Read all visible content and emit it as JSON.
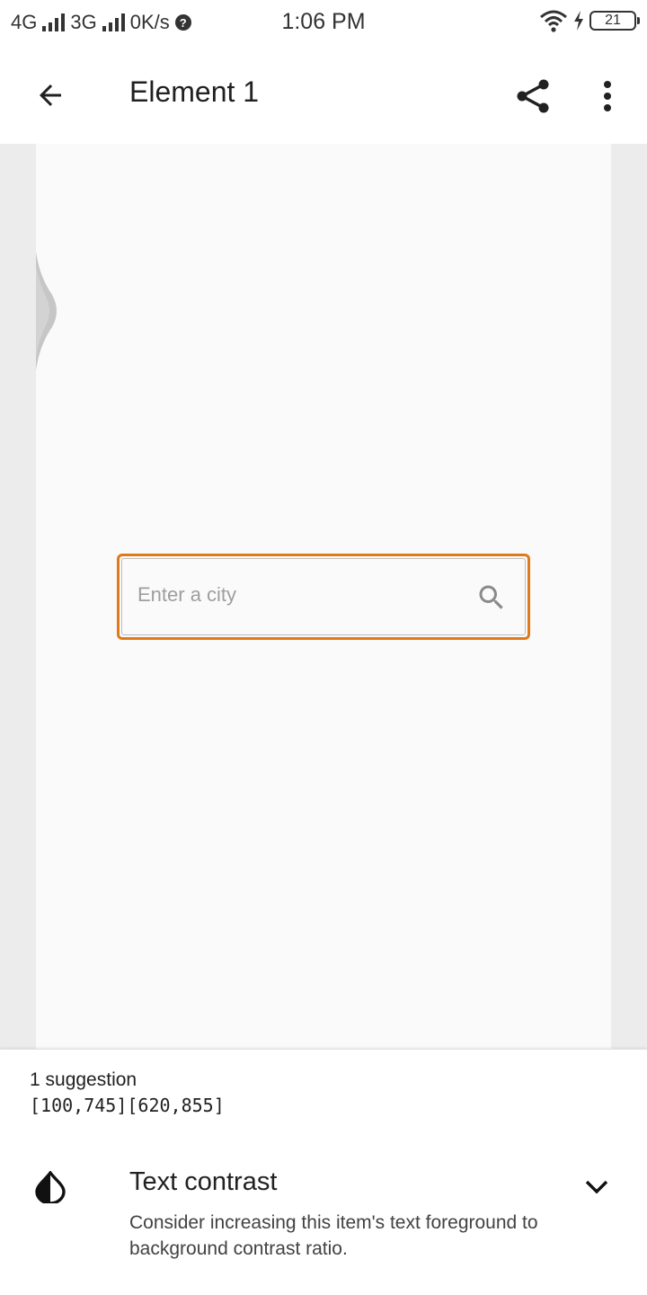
{
  "status_bar": {
    "network_1": "4G",
    "network_2": "3G",
    "speed": "0K/s",
    "time": "1:06 PM",
    "battery_level": "21",
    "icons": [
      "signal-icon",
      "help-icon",
      "wifi-icon",
      "charging-icon",
      "battery-icon"
    ]
  },
  "app_bar": {
    "title": "Element 1",
    "icons": [
      "back-arrow-icon",
      "share-icon",
      "more-vert-icon"
    ]
  },
  "preview": {
    "search_placeholder": "Enter a city",
    "highlight_color": "#e07a18",
    "icons": [
      "search-icon"
    ]
  },
  "suggestions": {
    "count_label": "1 suggestion",
    "bounds": "[100,745][620,855]",
    "items": [
      {
        "title": "Text contrast",
        "description": "Consider increasing this item's text foreground to background contrast ratio.",
        "icon": "contrast-icon"
      }
    ]
  }
}
